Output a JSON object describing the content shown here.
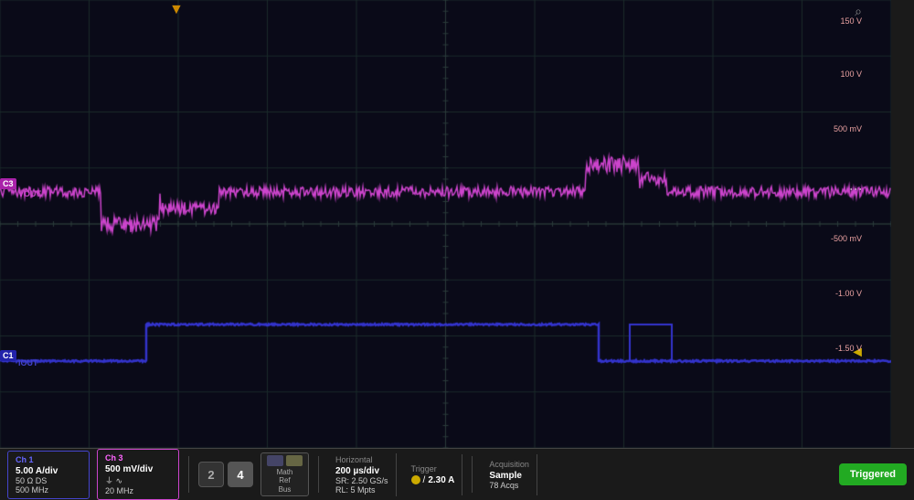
{
  "screen": {
    "background_color": "#0a0a1a",
    "grid_color": "#1e2e2e",
    "grid_cols": 10,
    "grid_rows": 8
  },
  "y_labels": [
    {
      "value": "150 V",
      "top_pct": 4
    },
    {
      "value": "100 V",
      "top_pct": 16
    },
    {
      "value": "500 mV",
      "top_pct": 28
    },
    {
      "value": "-500 mV",
      "top_pct": 52
    },
    {
      "value": "-1.00 V",
      "top_pct": 64
    },
    {
      "value": "-1.50 V",
      "top_pct": 76
    }
  ],
  "channels": {
    "ch1": {
      "label": "Ch 1",
      "color": "#4444ee",
      "vdiv": "5.00 A/div",
      "impedance": "50 Ω DS",
      "bandwidth": "500 MHz",
      "icon": "~"
    },
    "ch3": {
      "label": "Ch 3",
      "color": "#cc44cc",
      "vdiv": "500 mV/div",
      "coupling": "⏚",
      "bandwidth": "20 MHz",
      "icon": "~"
    }
  },
  "buttons": {
    "num2": "2",
    "num4": "4"
  },
  "math_ref_bus": {
    "label": "Math\nRef\nBus"
  },
  "horizontal": {
    "title": "Horizontal",
    "time_div": "200 µs/div",
    "sample_rate": "SR: 2.50 GS/s",
    "record_length": "RL: 5 Mpts"
  },
  "trigger": {
    "title": "Trigger",
    "icon_color": "#ccaa00",
    "slope": "/",
    "level": "2.30 A"
  },
  "acquisition": {
    "title": "Acquisition",
    "mode": "Sample",
    "acqs": "78 Acqs"
  },
  "status": {
    "label": "Triggered",
    "color": "#22aa22"
  },
  "markers": {
    "ch1_label": "C1",
    "ch3_label": "C3",
    "vout_label": "VOUT",
    "iout_label": "IOUT",
    "top_cursor_color": "#cc8800"
  }
}
